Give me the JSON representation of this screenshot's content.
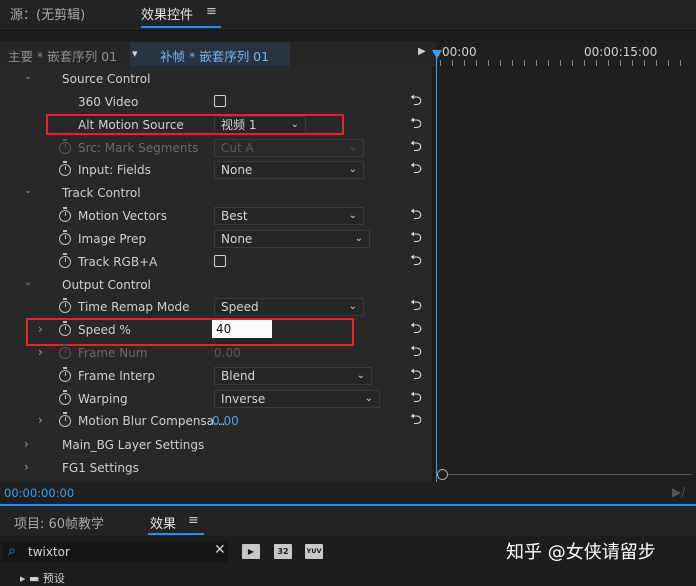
{
  "top_tabs": {
    "source_label": "源：(无剪辑)",
    "effect_controls_label": "效果控件",
    "menu_icon": "≡"
  },
  "sequence_bar": {
    "master_label": "主要 * 嵌套序列 01",
    "chevron": "▾",
    "clip_label": "补帧 * 嵌套序列 01",
    "play_icon": "▶"
  },
  "timeline": {
    "start_time": "00:00",
    "mid_time": "00:00:15:00"
  },
  "rows": [
    {
      "label": "Source Control",
      "type": "group"
    },
    {
      "label": "360 Video",
      "type": "checkbox"
    },
    {
      "label": "Alt Motion Source",
      "type": "dropdown",
      "value": "视频 1"
    },
    {
      "label": "Src: Mark Segments",
      "type": "dropdown",
      "value": "Cut A",
      "disabled": true
    },
    {
      "label": "Input: Fields",
      "type": "dropdown",
      "value": "None"
    },
    {
      "label": "Track Control",
      "type": "group"
    },
    {
      "label": "Motion Vectors",
      "type": "dropdown",
      "value": "Best"
    },
    {
      "label": "Image Prep",
      "type": "dropdown",
      "value": "None"
    },
    {
      "label": "Track RGB+A",
      "type": "checkbox"
    },
    {
      "label": "Output Control",
      "type": "group"
    },
    {
      "label": "Time Remap Mode",
      "type": "dropdown",
      "value": "Speed"
    },
    {
      "label": "Speed %",
      "type": "input",
      "value": "40"
    },
    {
      "label": "Frame Num",
      "type": "number",
      "value": "0.00",
      "disabled": true
    },
    {
      "label": "Frame Interp",
      "type": "dropdown",
      "value": "Blend"
    },
    {
      "label": "Warping",
      "type": "dropdown",
      "value": "Inverse"
    },
    {
      "label": "Motion Blur Compensa...",
      "type": "number",
      "value": "0.00"
    },
    {
      "label": "Main_BG Layer Settings",
      "type": "group"
    },
    {
      "label": "FG1 Settings",
      "type": "group"
    }
  ],
  "icons": {
    "reset": "⮌",
    "twirl_open": "⌄",
    "twirl_closed": "›",
    "dropdown_chevron": "⌄"
  },
  "timecode": "00:00:00:00",
  "bottom_tabs": {
    "project_label": "项目: 60帧教学",
    "effects_label": "效果",
    "menu_icon": "≡"
  },
  "search": {
    "value": "twixtor",
    "clear_icon": "✕"
  },
  "toolbar_icons": [
    "accelerated-effects-icon",
    "32bit-icon",
    "yuv-icon"
  ],
  "toolbar_labels": [
    "▶",
    "32",
    "YUV"
  ],
  "watermark": "知乎 @女侠请留步",
  "colors": {
    "accent": "#2d8ceb",
    "highlight_box": "#e2252b"
  }
}
